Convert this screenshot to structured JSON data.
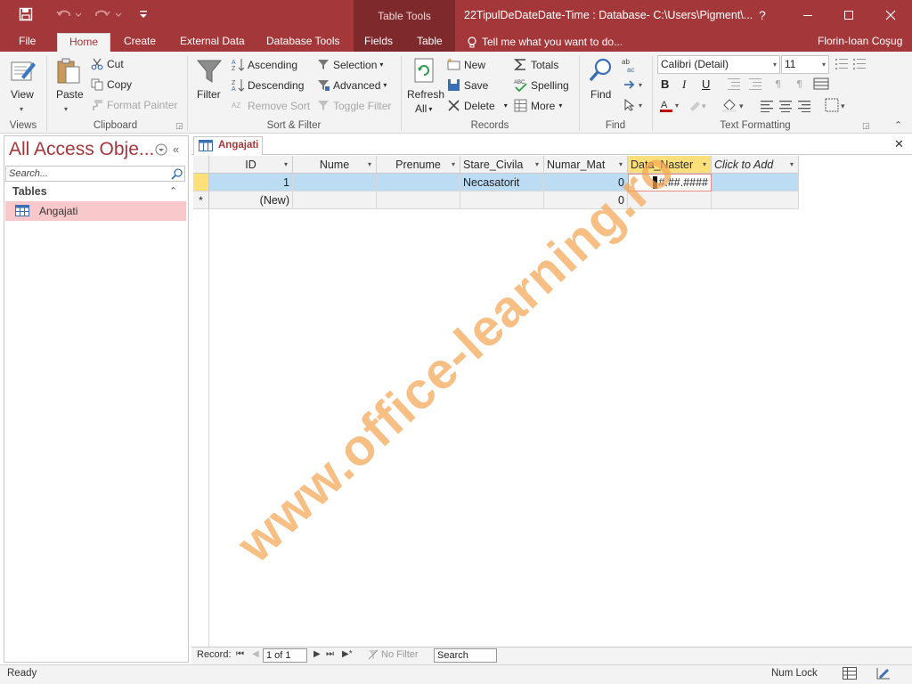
{
  "window": {
    "title": "22TipulDeDateDate-Time : Database- C:\\Users\\Pigment\\...",
    "context_group": "Table Tools",
    "user": "Florin-Ioan Coşug",
    "help": "?"
  },
  "tabs": [
    "File",
    "Home",
    "Create",
    "External Data",
    "Database Tools",
    "Fields",
    "Table"
  ],
  "tell_me": "Tell me what you want to do...",
  "ribbon": {
    "views": {
      "view": "View",
      "group": "Views"
    },
    "clipboard": {
      "paste": "Paste",
      "cut": "Cut",
      "copy": "Copy",
      "format_painter": "Format Painter",
      "group": "Clipboard"
    },
    "sort_filter": {
      "filter": "Filter",
      "ascending": "Ascending",
      "descending": "Descending",
      "remove_sort": "Remove Sort",
      "selection": "Selection",
      "advanced": "Advanced",
      "toggle_filter": "Toggle Filter",
      "group": "Sort & Filter"
    },
    "records": {
      "refresh": "Refresh",
      "refresh2": "All",
      "new": "New",
      "save": "Save",
      "delete": "Delete",
      "totals": "Totals",
      "spelling": "Spelling",
      "more": "More",
      "group": "Records"
    },
    "find": {
      "find": "Find",
      "group": "Find"
    },
    "text_formatting": {
      "font": "Calibri (Detail)",
      "size": "11",
      "bold": "B",
      "italic": "I",
      "underline": "U",
      "group": "Text Formatting"
    }
  },
  "nav": {
    "title": "All Access Obje...",
    "search_placeholder": "Search...",
    "section": "Tables",
    "items": [
      {
        "label": "Angajati"
      }
    ]
  },
  "doc_tab": "Angajati",
  "table": {
    "columns": [
      "ID",
      "Nume",
      "Prenume",
      "Stare_Civila",
      "Numar_Mat",
      "Data_Naster",
      "Click to Add"
    ],
    "rows": [
      {
        "ID": "1",
        "Nume": "",
        "Prenume": "",
        "Stare_Civila": "Necasatorit",
        "Numar_Mat": "0",
        "Data_Naster": "#.##.####"
      },
      {
        "ID": "(New)",
        "Nume": "",
        "Prenume": "",
        "Stare_Civila": "",
        "Numar_Mat": "0",
        "Data_Naster": ""
      }
    ]
  },
  "record_nav": {
    "label": "Record:",
    "position": "1 of 1",
    "filter": "No Filter",
    "search": "Search"
  },
  "status": {
    "left": "Ready",
    "numlock": "Num Lock"
  },
  "watermark": "www.office-learning.ro",
  "colors": {
    "accent": "#a4373a",
    "selected_row": "#bcdcf4",
    "nav_selected": "#f8c8cb",
    "active_header": "#fde07a",
    "watermark": "#f4a654"
  }
}
